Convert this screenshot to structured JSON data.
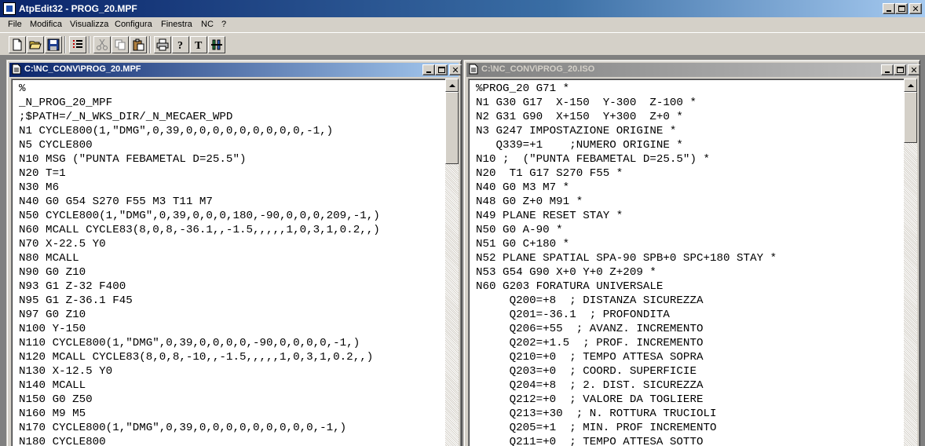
{
  "app": {
    "title": "AtpEdit32 - PROG_20.MPF"
  },
  "menu": [
    "File",
    "Modifica",
    "Visualizza",
    "Configura",
    "Finestra",
    "NC",
    "?"
  ],
  "toolbar": {
    "buttons": [
      "new-file",
      "open-folder",
      "save",
      "list",
      "cut",
      "copy",
      "paste",
      "print",
      "help",
      "text-format",
      "tools"
    ]
  },
  "left_window": {
    "title": "C:\\NC_CONV\\PROG_20.MPF",
    "lines": [
      "%",
      "_N_PROG_20_MPF",
      ";$PATH=/_N_WKS_DIR/_N_MECAER_WPD",
      "N1 CYCLE800(1,\"DMG\",0,39,0,0,0,0,0,0,0,0,0,-1,)",
      "N5 CYCLE800",
      "N10 MSG (\"PUNTA FEBAMETAL D=25.5\")",
      "N20 T=1",
      "N30 M6",
      "N40 G0 G54 S270 F55 M3 T11 M7",
      "N50 CYCLE800(1,\"DMG\",0,39,0,0,0,180,-90,0,0,0,209,-1,)",
      "N60 MCALL CYCLE83(8,0,8,-36.1,,-1.5,,,,,1,0,3,1,0.2,,)",
      "N70 X-22.5 Y0",
      "N80 MCALL",
      "N90 G0 Z10",
      "N93 G1 Z-32 F400",
      "N95 G1 Z-36.1 F45",
      "N97 G0 Z10",
      "N100 Y-150",
      "N110 CYCLE800(1,\"DMG\",0,39,0,0,0,0,-90,0,0,0,0,-1,)",
      "N120 MCALL CYCLE83(8,0,8,-10,,-1.5,,,,,1,0,3,1,0.2,,)",
      "N130 X-12.5 Y0",
      "N140 MCALL",
      "N150 G0 Z50",
      "N160 M9 M5",
      "N170 CYCLE800(1,\"DMG\",0,39,0,0,0,0,0,0,0,0,0,-1,)",
      "N180 CYCLE800"
    ]
  },
  "right_window": {
    "title": "C:\\NC_CONV\\PROG_20.ISO",
    "lines": [
      "%PROG_20 G71 *",
      "N1 G30 G17  X-150  Y-300  Z-100 *",
      "N2 G31 G90  X+150  Y+300  Z+0 *",
      "N3 G247 IMPOSTAZIONE ORIGINE *",
      "   Q339=+1    ;NUMERO ORIGINE *",
      "N10 ;  (\"PUNTA FEBAMETAL D=25.5\") *",
      "N20  T1 G17 S270 F55 *",
      "N40 G0 M3 M7 *",
      "N48 G0 Z+0 M91 *",
      "N49 PLANE RESET STAY *",
      "N50 G0 A-90 *",
      "N51 G0 C+180 *",
      "N52 PLANE SPATIAL SPA-90 SPB+0 SPC+180 STAY *",
      "N53 G54 G90 X+0 Y+0 Z+209 *",
      "N60 G203 FORATURA UNIVERSALE",
      "     Q200=+8  ; DISTANZA SICUREZZA",
      "     Q201=-36.1  ; PROFONDITA",
      "     Q206=+55  ; AVANZ. INCREMENTO",
      "     Q202=+1.5  ; PROF. INCREMENTO",
      "     Q210=+0  ; TEMPO ATTESA SOPRA",
      "     Q203=+0  ; COORD. SUPERFICIE",
      "     Q204=+8  ; 2. DIST. SICUREZZA",
      "     Q212=+0  ; VALORE DA TOGLIERE",
      "     Q213=+30  ; N. ROTTURA TRUCIOLI",
      "     Q205=+1  ; MIN. PROF INCREMENTO",
      "     Q211=+0  ; TEMPO ATTESA SOTTO"
    ]
  }
}
